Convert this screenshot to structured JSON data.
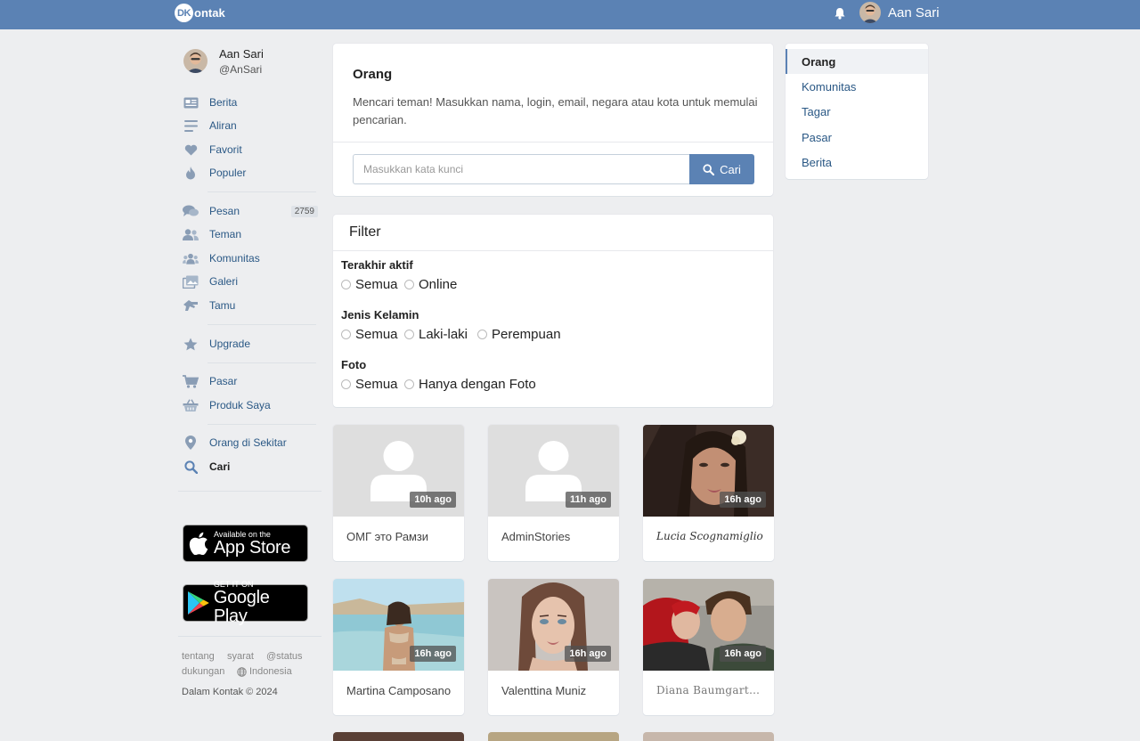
{
  "header": {
    "logo_badge": "DK",
    "logo_text": "ontak",
    "user_name": "Aan Sari"
  },
  "profile": {
    "name": "Aan Sari",
    "login": "@AnSari"
  },
  "sidebar": {
    "items": [
      {
        "label": "Berita",
        "icon": "news-icon"
      },
      {
        "label": "Aliran",
        "icon": "stream-icon"
      },
      {
        "label": "Favorit",
        "icon": "heart-icon"
      },
      {
        "label": "Populer",
        "icon": "flame-icon"
      },
      {
        "label": "Pesan",
        "icon": "chat-icon",
        "count": "2759"
      },
      {
        "label": "Teman",
        "icon": "friends-icon"
      },
      {
        "label": "Komunitas",
        "icon": "community-icon"
      },
      {
        "label": "Galeri",
        "icon": "gallery-icon"
      },
      {
        "label": "Tamu",
        "icon": "guests-icon"
      },
      {
        "label": "Upgrade",
        "icon": "star-icon"
      },
      {
        "label": "Pasar",
        "icon": "cart-icon"
      },
      {
        "label": "Produk Saya",
        "icon": "basket-icon"
      },
      {
        "label": "Orang di Sekitar",
        "icon": "location-icon"
      },
      {
        "label": "Cari",
        "icon": "search-icon"
      }
    ]
  },
  "stores": {
    "apple_small": "Available on the",
    "apple_big": "App Store",
    "google_small": "GET IT ON",
    "google_big": "Google Play"
  },
  "footer": {
    "links": [
      "tentang",
      "syarat",
      "@status",
      "dukungan",
      "Indonesia"
    ],
    "copyright": "Dalam Kontak © 2024"
  },
  "search": {
    "title": "Orang",
    "description": "Mencari teman! Masukkan nama, login, email, negara atau kota untuk memulai pencarian.",
    "placeholder": "Masukkan kata kunci",
    "button": "Cari"
  },
  "filter": {
    "title": "Filter",
    "groups": [
      {
        "label": "Terakhir aktif",
        "options": [
          "Semua",
          "Online"
        ]
      },
      {
        "label": "Jenis Kelamin",
        "options": [
          "Semua",
          "Laki-laki",
          "Perempuan"
        ]
      },
      {
        "label": "Foto",
        "options": [
          "Semua",
          "Hanya dengan Foto"
        ]
      }
    ]
  },
  "right_menu": {
    "items": [
      "Orang",
      "Komunitas",
      "Tagar",
      "Pasar",
      "Berita"
    ],
    "active": "Orang"
  },
  "people": [
    {
      "name": "ОМГ это Рамзи",
      "ago": "10h ago",
      "photo": "placeholder"
    },
    {
      "name": "AdminStories",
      "ago": "11h ago",
      "photo": "placeholder"
    },
    {
      "name": "Lucia Scognamiglio",
      "ago": "16h ago",
      "photo": "portrait"
    },
    {
      "name": "Martina Camposano",
      "ago": "16h ago",
      "photo": "beach"
    },
    {
      "name": "Valenttina Muniz",
      "ago": "16h ago",
      "photo": "portrait"
    },
    {
      "name": "Diana Baumgartne…",
      "ago": "16h ago",
      "photo": "couple"
    }
  ],
  "colors": {
    "header": "#5b82b4",
    "link": "#2a5885",
    "background": "#edeef0"
  }
}
